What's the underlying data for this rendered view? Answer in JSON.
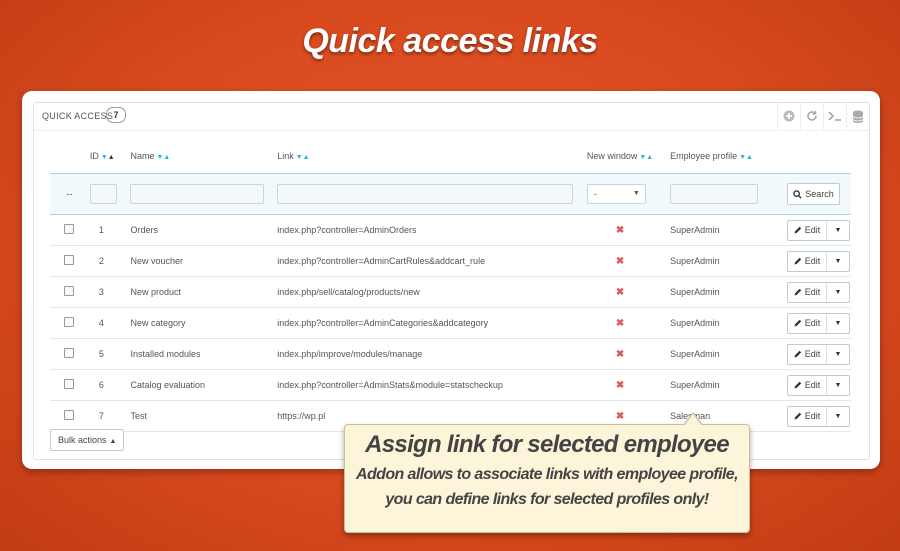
{
  "hero_title": "Quick access links",
  "panel": {
    "title": "QUICK ACCESS",
    "count": "7",
    "toolbar_icons": [
      "add-icon",
      "refresh-icon",
      "terminal-icon",
      "database-icon"
    ]
  },
  "columns": {
    "id": "ID",
    "name": "Name",
    "link": "Link",
    "new_window": "New window",
    "employee_profile": "Employee profile"
  },
  "filters": {
    "checkbox_placeholder": "--",
    "new_window_selected": "-",
    "search_label": "Search"
  },
  "rows": [
    {
      "id": "1",
      "name": "Orders",
      "link": "index.php?controller=AdminOrders",
      "new_window": "✖",
      "profile": "SuperAdmin",
      "edit": "Edit"
    },
    {
      "id": "2",
      "name": "New voucher",
      "link": "index.php?controller=AdminCartRules&addcart_rule",
      "new_window": "✖",
      "profile": "SuperAdmin",
      "edit": "Edit"
    },
    {
      "id": "3",
      "name": "New product",
      "link": "index.php/sell/catalog/products/new",
      "new_window": "✖",
      "profile": "SuperAdmin",
      "edit": "Edit"
    },
    {
      "id": "4",
      "name": "New category",
      "link": "index.php?controller=AdminCategories&addcategory",
      "new_window": "✖",
      "profile": "SuperAdmin",
      "edit": "Edit"
    },
    {
      "id": "5",
      "name": "Installed modules",
      "link": "index.php/improve/modules/manage",
      "new_window": "✖",
      "profile": "SuperAdmin",
      "edit": "Edit"
    },
    {
      "id": "6",
      "name": "Catalog evaluation",
      "link": "index.php?controller=AdminStats&module=statscheckup",
      "new_window": "✖",
      "profile": "SuperAdmin",
      "edit": "Edit"
    },
    {
      "id": "7",
      "name": "Test",
      "link": "https://wp.pl",
      "new_window": "✖",
      "profile": "Salesman",
      "edit": "Edit"
    }
  ],
  "bulk_actions": "Bulk actions",
  "callout": {
    "title": "Assign link for selected employee",
    "line1": "Addon allows to associate links with employee profile,",
    "line2": "you can define links for selected profiles only!"
  },
  "colors": {
    "background": "#d94a1f",
    "accent": "#25b9d7",
    "error": "#e05a5a",
    "callout_bg": "#fdf5d9"
  }
}
